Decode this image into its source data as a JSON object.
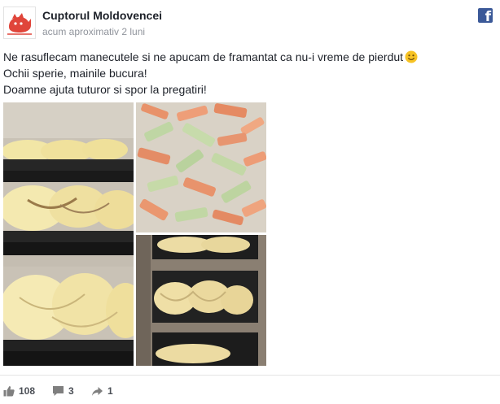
{
  "post": {
    "page_name": "Cuptorul Moldovencei",
    "timestamp": "acum aproximativ 2 luni",
    "text_lines": [
      "Ne rasuflecam manecutele si ne apucam de framantat ca nu-i vreme de pierdut",
      "Ochii sperie, mainile bucura!",
      "Doamne ajuta tuturor si spor la pregatiri!"
    ],
    "emoji": "smiley-emoji"
  },
  "photos": [
    {
      "name": "braided-bread-loaves-in-pans"
    },
    {
      "name": "candied-fruit-pieces"
    },
    {
      "name": "braided-dough-in-baking-tins"
    }
  ],
  "stats": {
    "likes": "108",
    "comments": "3",
    "shares": "1"
  },
  "colors": {
    "facebook_blue": "#3b5998",
    "text": "#1d2129",
    "meta": "#90949c",
    "action_text": "#4b4f56",
    "logo_red": "#e0453a"
  },
  "icons": {
    "brand": "facebook-icon",
    "like": "thumbs-up-icon",
    "comment": "comment-icon",
    "share": "share-arrow-icon"
  }
}
